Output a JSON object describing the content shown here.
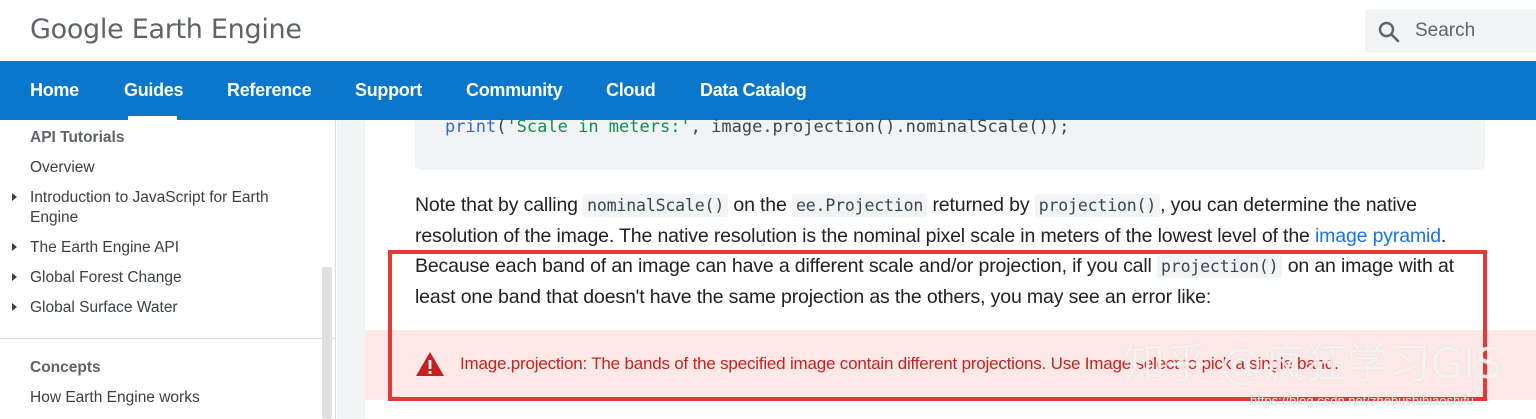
{
  "header": {
    "logo_google": "Google",
    "logo_product": "Earth Engine",
    "search_placeholder": "Search"
  },
  "nav": {
    "items": [
      "Home",
      "Guides",
      "Reference",
      "Support",
      "Community",
      "Cloud",
      "Data Catalog"
    ],
    "active": "Guides"
  },
  "sidebar": {
    "section1_title": "API Tutorials",
    "items": [
      {
        "label": "Overview",
        "expandable": false
      },
      {
        "label": "Introduction to JavaScript for Earth Engine",
        "expandable": true
      },
      {
        "label": "The Earth Engine API",
        "expandable": true
      },
      {
        "label": "Global Forest Change",
        "expandable": true
      },
      {
        "label": "Global Surface Water",
        "expandable": true
      }
    ],
    "section2_title": "Concepts",
    "section2_items": [
      "How Earth Engine works"
    ]
  },
  "main": {
    "code_kw": "print",
    "code_open": "(",
    "code_str": "'Scale in meters:'",
    "code_rest": ", image.projection().nominalScale());",
    "p1": "Note that by calling ",
    "c1": "nominalScale()",
    "p2": " on the ",
    "c2": "ee.Projection",
    "p3": " returned by ",
    "c3": "projection()",
    "p4": ", you can determine the native resolution of the image. The native resolution is the nominal pixel scale in meters of the lowest level of the ",
    "link": "image pyramid",
    "p5": ". Because each band of an image can have a different scale and/or projection, if you call ",
    "c4": "projection()",
    "p6": " on an image with at least one band that doesn't have the same projection as the others, you may see an error like:",
    "error_text": "Image.projection: The bands of the specified image contain different projections. Use Image.select to pick a single band."
  },
  "watermark": {
    "text": "知乎 @疯狂学习GIS",
    "url": "https://blog.csdn.net/zhebushibiaoshifu"
  },
  "colors": {
    "nav_bg": "#0a77cd",
    "link": "#1a73e8",
    "error_bg": "#fce8e6",
    "error_text": "#c5221f",
    "highlight_box": "#e53935"
  }
}
